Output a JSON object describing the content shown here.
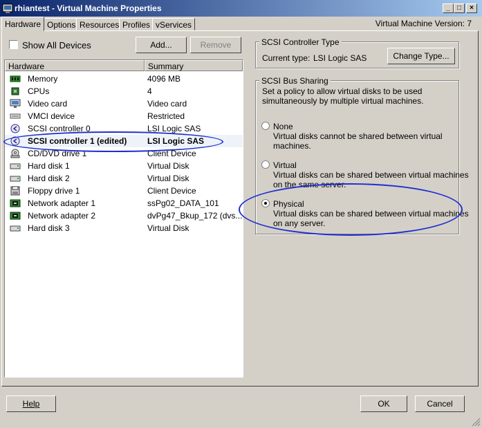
{
  "window": {
    "title": "rhiantest - Virtual Machine Properties",
    "controls": {
      "minimize": "_",
      "maximize": "□",
      "close": "×"
    }
  },
  "tabs": [
    {
      "label": "Hardware",
      "active": true
    },
    {
      "label": "Options"
    },
    {
      "label": "Resources"
    },
    {
      "label": "Profiles"
    },
    {
      "label": "vServices"
    }
  ],
  "vm_version": "Virtual Machine Version: 7",
  "left": {
    "show_all_devices": "Show All Devices",
    "add_button": "Add...",
    "remove_button": "Remove",
    "columns": {
      "hardware": "Hardware",
      "summary": "Summary"
    },
    "rows": [
      {
        "name": "Memory",
        "summary": "4096 MB",
        "icon": "memory-icon"
      },
      {
        "name": "CPUs",
        "summary": "4",
        "icon": "cpu-icon"
      },
      {
        "name": "Video card",
        "summary": "Video card",
        "icon": "monitor-icon"
      },
      {
        "name": "VMCI device",
        "summary": "Restricted",
        "icon": "device-icon"
      },
      {
        "name": "SCSI controller 0",
        "summary": "LSI Logic SAS",
        "icon": "scsi-icon"
      },
      {
        "name": "SCSI controller 1 (edited)",
        "summary": "LSI Logic SAS",
        "icon": "scsi-icon",
        "selected": true
      },
      {
        "name": "CD/DVD drive 1",
        "summary": "Client Device",
        "icon": "cd-icon"
      },
      {
        "name": "Hard disk 1",
        "summary": "Virtual Disk",
        "icon": "disk-icon"
      },
      {
        "name": "Hard disk 2",
        "summary": "Virtual Disk",
        "icon": "disk-icon"
      },
      {
        "name": "Floppy drive 1",
        "summary": "Client Device",
        "icon": "floppy-icon"
      },
      {
        "name": "Network adapter 1",
        "summary": "ssPg02_DATA_101",
        "icon": "network-icon"
      },
      {
        "name": "Network adapter 2",
        "summary": "dvPg47_Bkup_172 (dvs...",
        "icon": "network-icon"
      },
      {
        "name": "Hard disk 3",
        "summary": "Virtual Disk",
        "icon": "disk-icon"
      }
    ]
  },
  "right": {
    "controller_type": {
      "title": "SCSI Controller Type",
      "current_label": "Current type:",
      "current_value": "LSI Logic SAS",
      "change_button": "Change Type..."
    },
    "bus_sharing": {
      "title": "SCSI Bus Sharing",
      "description_1": "Set a policy to allow virtual disks to be used",
      "description_2": "simultaneously by multiple virtual machines.",
      "options": [
        {
          "label": "None",
          "line1": "Virtual disks cannot be shared between virtual",
          "line2": "machines."
        },
        {
          "label": "Virtual",
          "line1": "Virtual disks can be shared between virtual machines",
          "line2": "on the same server."
        },
        {
          "label": "Physical",
          "line1": "Virtual disks can be shared between virtual machines",
          "line2": "on any server.",
          "selected": true
        }
      ]
    }
  },
  "footer": {
    "help": "Help",
    "ok": "OK",
    "cancel": "Cancel"
  },
  "colors": {
    "annotation": "#1f2fd0",
    "titlebar_start": "#0a246a",
    "titlebar_end": "#a6caf0"
  }
}
